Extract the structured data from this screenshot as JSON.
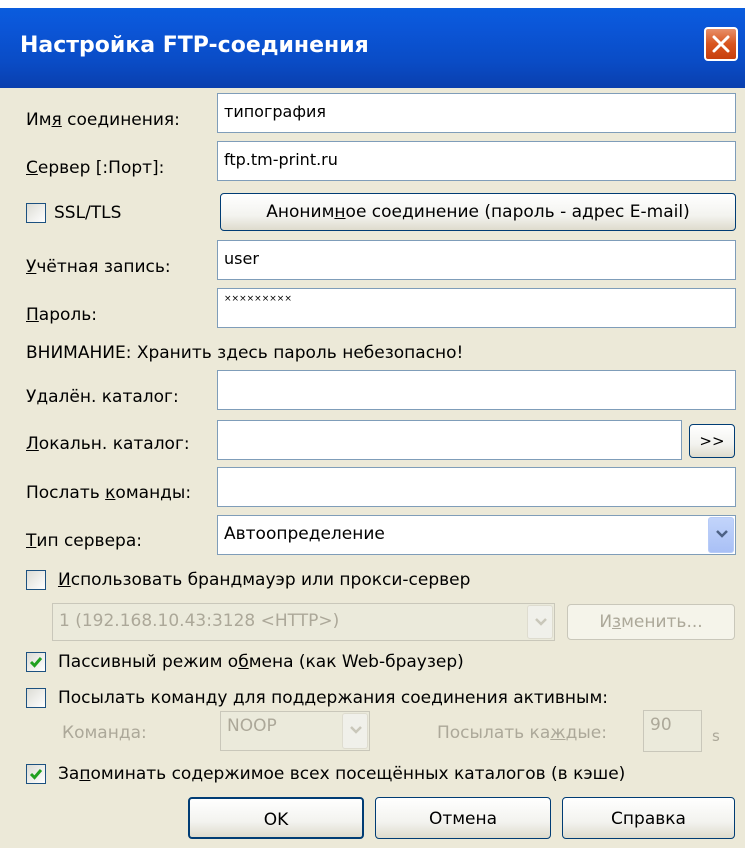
{
  "window": {
    "title": "Настройка FTP-соединения"
  },
  "fields": {
    "connection_name": {
      "label_pre": "Им",
      "label_ul": "я",
      "label_post": " соединения:",
      "value": "типография"
    },
    "server": {
      "label_pre": "",
      "label_ul": "С",
      "label_post": "ервер [:Порт]:",
      "value": "ftp.tm-print.ru"
    },
    "account": {
      "label_pre": "",
      "label_ul": "У",
      "label_post": "чётная запись:",
      "value": "user"
    },
    "password": {
      "label_pre": "",
      "label_ul": "П",
      "label_post": "ароль:",
      "value": "×××××××××"
    },
    "remote_dir": {
      "label_pre": "У",
      "label_ul": "д",
      "label_post": "алён. каталог:",
      "value": ""
    },
    "local_dir": {
      "label_pre": "",
      "label_ul": "Л",
      "label_post": "окальн. каталог:",
      "value": ""
    },
    "send_commands": {
      "label_pre": "Послать ",
      "label_ul": "к",
      "label_post": "оманды:",
      "value": ""
    },
    "server_type": {
      "label_pre": "",
      "label_ul": "Т",
      "label_post": "ип сервера:",
      "value": "Автоопределение"
    }
  },
  "ssl": {
    "label": "SSL/TLS",
    "checked": false
  },
  "anon_button": {
    "pre": "Аноним",
    "ul": "н",
    "post": "ое соединение (пароль - адрес E-mail)"
  },
  "warning": "ВНИМАНИЕ: Хранить здесь пароль небезопасно!",
  "browse_button": ">>",
  "firewall": {
    "checkbox": {
      "pre": "",
      "ul": "И",
      "post": "спользовать брандмауэр или прокси-сервер",
      "checked": false
    },
    "proxy_value": "1 (192.168.10.43:3128 <HTTP>)",
    "edit_button": {
      "pre": "И",
      "ul": "з",
      "post": "менить..."
    }
  },
  "passive": {
    "pre": "Пассивный режим о",
    "ul": "б",
    "post": "мена (как Web-браузер)",
    "checked": true
  },
  "keepalive": {
    "checkbox": {
      "pre": "Посылать коман",
      "ul": "д",
      "post": "у для поддержания соединения активным:",
      "checked": false
    },
    "command_label": {
      "pre": "Коман",
      "ul": "д",
      "post": "а:"
    },
    "command_value": "NOOP",
    "interval_label": {
      "pre": "Посылать ка",
      "ul": "ж",
      "post": "дые:"
    },
    "interval_value": "90",
    "interval_unit": "s"
  },
  "cache": {
    "pre": "За",
    "ul": "п",
    "post": "оминать содержимое всех посещённых каталогов (в кэше)",
    "checked": true
  },
  "buttons": {
    "ok": "OK",
    "cancel": "Отмена",
    "help": "Справка"
  },
  "colors": {
    "title_bar": "#0a56d8",
    "dialog_bg": "#ece9d8",
    "close_button": "#d9551f",
    "checkmark": "#21a121"
  }
}
